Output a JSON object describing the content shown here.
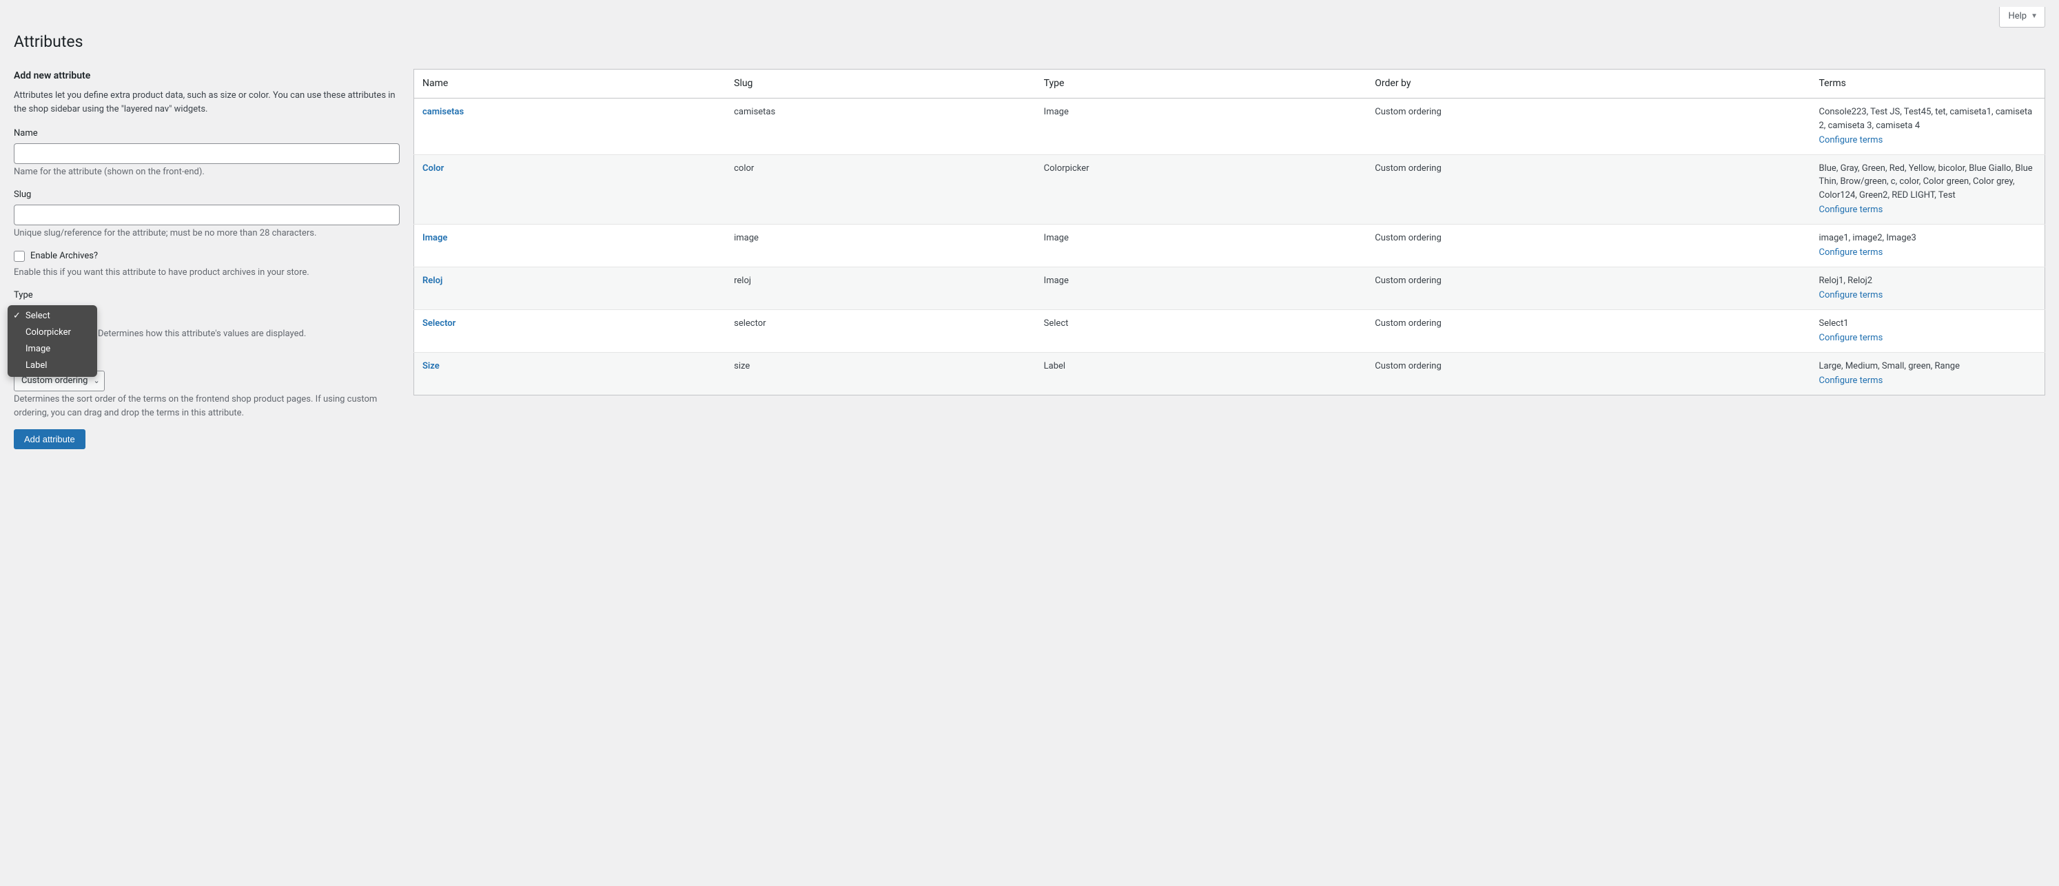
{
  "help_label": "Help",
  "page_title": "Attributes",
  "form": {
    "section_title": "Add new attribute",
    "intro": "Attributes let you define extra product data, such as size or color. You can use these attributes in the shop sidebar using the \"layered nav\" widgets.",
    "name_label": "Name",
    "name_hint": "Name for the attribute (shown on the front-end).",
    "slug_label": "Slug",
    "slug_hint": "Unique slug/reference for the attribute; must be no more than 28 characters.",
    "archives_label": "Enable Archives?",
    "archives_hint": "Enable this if you want this attribute to have product archives in your store.",
    "type_label": "Type",
    "type_hint": "Determines how this attribute's values are displayed.",
    "type_options": [
      {
        "label": "Select",
        "selected": true
      },
      {
        "label": "Colorpicker",
        "selected": false
      },
      {
        "label": "Image",
        "selected": false
      },
      {
        "label": "Label",
        "selected": false
      }
    ],
    "sort_selected": "Custom ordering",
    "sort_hint": "Determines the sort order of the terms on the frontend shop product pages. If using custom ordering, you can drag and drop the terms in this attribute.",
    "submit_label": "Add attribute"
  },
  "table": {
    "headers": {
      "name": "Name",
      "slug": "Slug",
      "type": "Type",
      "order": "Order by",
      "terms": "Terms"
    },
    "configure_label": "Configure terms",
    "rows": [
      {
        "name": "camisetas",
        "slug": "camisetas",
        "type": "Image",
        "order": "Custom ordering",
        "terms": "Console223, Test JS, Test45, tet, camiseta1, camiseta 2, camiseta 3, camiseta 4"
      },
      {
        "name": "Color",
        "slug": "color",
        "type": "Colorpicker",
        "order": "Custom ordering",
        "terms": "Blue, Gray, Green, Red, Yellow, bicolor, Blue Giallo, Blue Thin, Brow/green, c, color, Color green, Color grey, Color124, Green2, RED LIGHT, Test"
      },
      {
        "name": "Image",
        "slug": "image",
        "type": "Image",
        "order": "Custom ordering",
        "terms": "image1, image2, Image3"
      },
      {
        "name": "Reloj",
        "slug": "reloj",
        "type": "Image",
        "order": "Custom ordering",
        "terms": "Reloj1, Reloj2"
      },
      {
        "name": "Selector",
        "slug": "selector",
        "type": "Select",
        "order": "Custom ordering",
        "terms": "Select1"
      },
      {
        "name": "Size",
        "slug": "size",
        "type": "Label",
        "order": "Custom ordering",
        "terms": "Large, Medium, Small, green, Range"
      }
    ]
  }
}
